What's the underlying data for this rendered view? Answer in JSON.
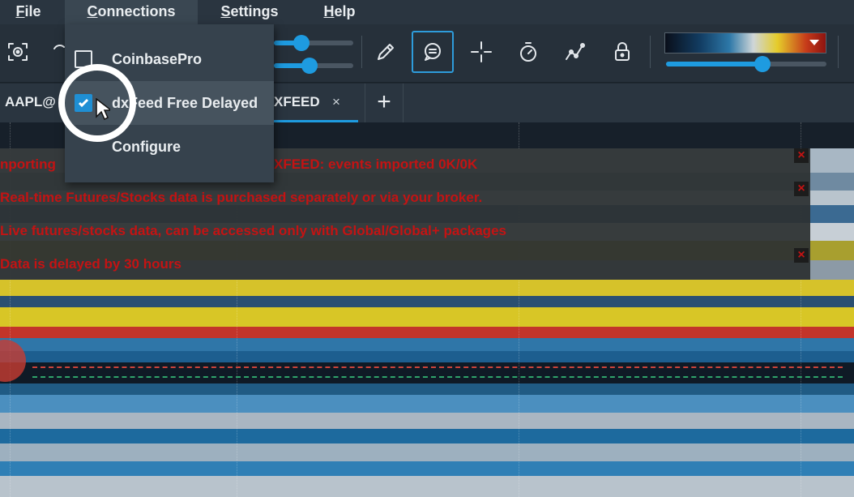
{
  "menubar": {
    "file": {
      "lead": "F",
      "rest": "ile"
    },
    "connections": {
      "lead": "C",
      "rest": "onnections"
    },
    "settings": {
      "lead": "S",
      "rest": "ettings"
    },
    "help": {
      "lead": "H",
      "rest": "elp"
    }
  },
  "connections_menu": {
    "items": [
      {
        "label": "CoinbasePro",
        "checked": false
      },
      {
        "label": "dxFeed Free Delayed",
        "checked": true
      },
      {
        "label": "Configure"
      }
    ]
  },
  "toolbar": {
    "icons": [
      "screenshot-icon",
      "pencil-icon",
      "chat-icon",
      "crosshair-icon",
      "timer-icon",
      "indicators-icon",
      "lock-icon"
    ],
    "active_icon": "chat-icon",
    "slider_top_level": 0.35,
    "slider_bottom_level": 0.45,
    "right_slider_level": 0.6,
    "colors": {
      "accent": "#1e9be0"
    }
  },
  "tabs": {
    "first": "AAPL@",
    "active": "XFEED",
    "close_glyph": "×",
    "add_glyph": "+"
  },
  "chart": {
    "messages": [
      "nporting",
      "XFEED: events imported 0K/0K",
      "Real-time Futures/Stocks data is purchased separately or via your broker.",
      "Live futures/stocks data, can be accessed only with Global/Global+ packages",
      "Data is delayed by 30 hours"
    ],
    "close_glyph": "×",
    "colors": {
      "message_text": "#c41313",
      "message_bg": "#2c3032",
      "dash_red": "#c9423a",
      "dash_green": "#2fa36b"
    }
  }
}
